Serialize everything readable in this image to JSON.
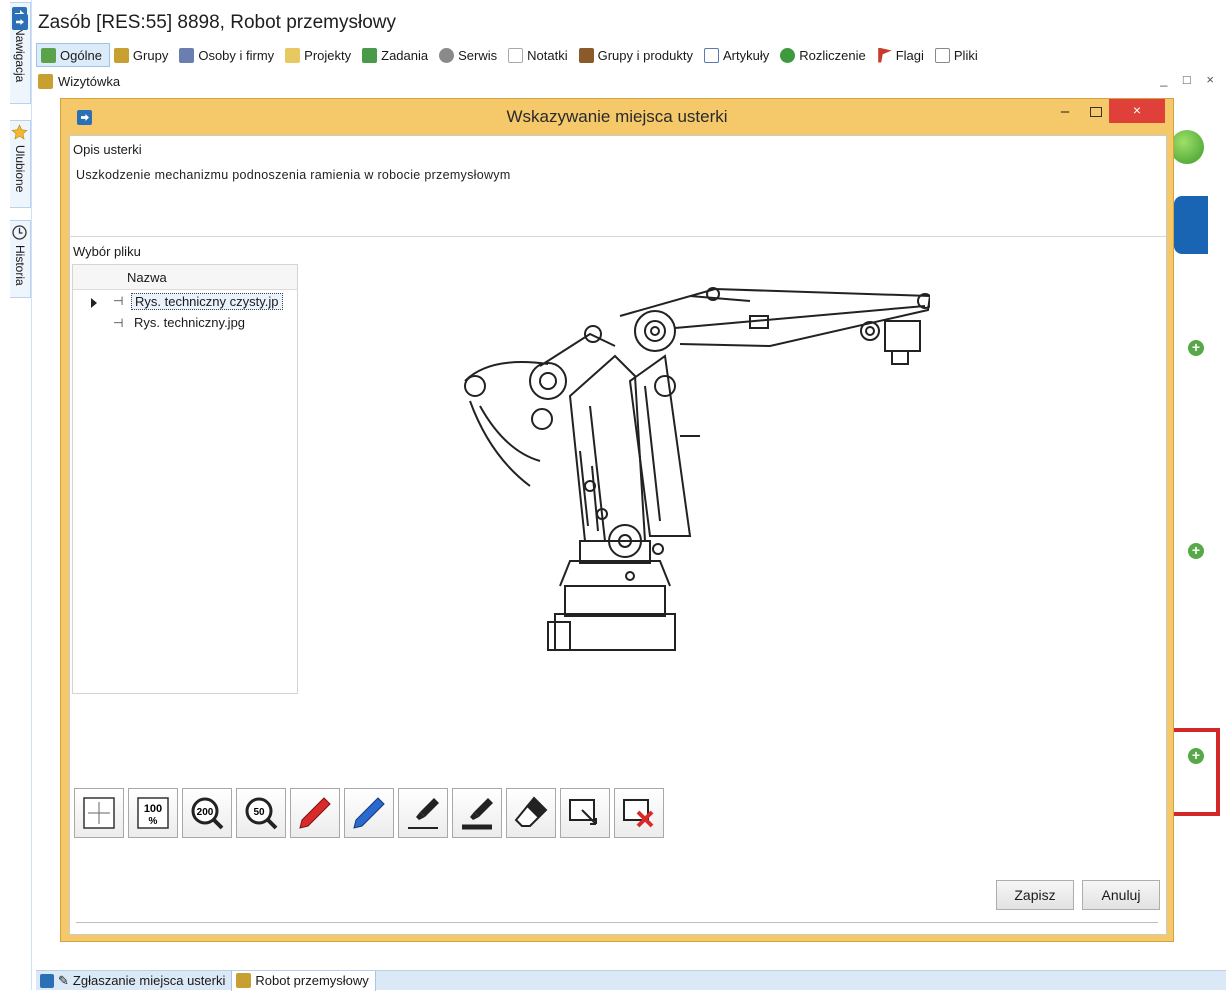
{
  "window": {
    "title": "Zasób [RES:55] 8898, Robot przemysłowy"
  },
  "side_tabs": [
    {
      "label": "Nawigacja",
      "icon": "arrow-right-icon"
    },
    {
      "label": "Ulubione",
      "icon": "star-icon"
    },
    {
      "label": "Historia",
      "icon": "clock-icon"
    }
  ],
  "tabs": [
    {
      "label": "Ogólne",
      "icon": "general-icon",
      "color": "#5aa34a",
      "active": true
    },
    {
      "label": "Grupy",
      "icon": "groups-icon",
      "color": "#c8a032"
    },
    {
      "label": "Osoby i firmy",
      "icon": "people-icon",
      "color": "#6a7fb0"
    },
    {
      "label": "Projekty",
      "icon": "folder-icon",
      "color": "#e8c860"
    },
    {
      "label": "Zadania",
      "icon": "tasks-icon",
      "color": "#4a9a4a"
    },
    {
      "label": "Serwis",
      "icon": "service-icon",
      "color": "#8a8a8a"
    },
    {
      "label": "Notatki",
      "icon": "notes-icon",
      "color": "#d0d0d0"
    },
    {
      "label": "Grupy i produkty",
      "icon": "products-icon",
      "color": "#8b5a2b"
    },
    {
      "label": "Artykuły",
      "icon": "articles-icon",
      "color": "#5a7ab0"
    },
    {
      "label": "Rozliczenie",
      "icon": "billing-icon",
      "color": "#3e9a3e"
    },
    {
      "label": "Flagi",
      "icon": "flag-icon",
      "color": "#c83a2a"
    },
    {
      "label": "Pliki",
      "icon": "file-icon",
      "color": "#bcbcbc"
    }
  ],
  "subbar": {
    "label": "Wizytówka",
    "window_controls": "_ □ ×"
  },
  "dialog": {
    "title": "Wskazywanie miejsca usterki",
    "close_glyph": "×",
    "minimize_glyph": "–",
    "description_label": "Opis usterki",
    "description": "Uszkodzenie mechanizmu podnoszenia ramienia w robocie przemysłowym",
    "file_section_label": "Wybór pliku",
    "file_grid": {
      "column": "Nazwa",
      "rows": [
        {
          "name": "Rys. techniczny czysty.jp",
          "selected": true
        },
        {
          "name": "Rys. techniczny.jpg",
          "selected": false
        }
      ]
    },
    "tools": [
      {
        "name": "fit-to-window-icon"
      },
      {
        "name": "zoom-100-icon",
        "text": "100 %"
      },
      {
        "name": "zoom-200-icon",
        "text": "200"
      },
      {
        "name": "zoom-50-icon",
        "text": "50"
      },
      {
        "name": "red-pen-icon",
        "color": "#d82a2a"
      },
      {
        "name": "blue-pen-icon",
        "color": "#2a6ad0"
      },
      {
        "name": "marker-thin-icon"
      },
      {
        "name": "marker-thick-icon"
      },
      {
        "name": "eraser-icon"
      },
      {
        "name": "select-area-icon"
      },
      {
        "name": "clear-area-icon",
        "color": "#d82a2a"
      }
    ],
    "save_label": "Zapisz",
    "cancel_label": "Anuluj"
  },
  "taskbar": {
    "items": [
      {
        "label": "Zgłaszanie miejsca usterki",
        "icon": "edit-icon",
        "active": false
      },
      {
        "label": "Robot przemysłowy",
        "icon": "resource-icon",
        "active": true
      }
    ]
  },
  "colors": {
    "dialog_frame": "#f5c86a",
    "close_button": "#e0403a",
    "highlight_red": "#d42828",
    "accent_blue": "#1a64b4"
  }
}
